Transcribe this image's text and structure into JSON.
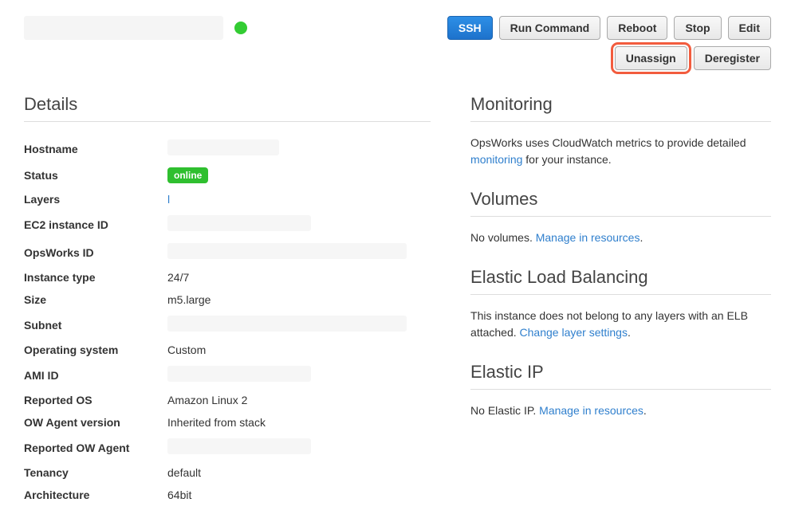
{
  "toolbar": {
    "ssh": "SSH",
    "run_command": "Run Command",
    "reboot": "Reboot",
    "stop": "Stop",
    "edit": "Edit",
    "unassign": "Unassign",
    "deregister": "Deregister"
  },
  "details": {
    "heading": "Details",
    "rows": {
      "hostname_label": "Hostname",
      "status_label": "Status",
      "status_badge": "online",
      "layers_label": "Layers",
      "layers_value": "l",
      "ec2id_label": "EC2 instance ID",
      "opsworksid_label": "OpsWorks ID",
      "instance_type_label": "Instance type",
      "instance_type_value": "24/7",
      "size_label": "Size",
      "size_value": "m5.large",
      "subnet_label": "Subnet",
      "os_label": "Operating system",
      "os_value": "Custom",
      "amiid_label": "AMI ID",
      "reported_os_label": "Reported OS",
      "reported_os_value": "Amazon Linux 2",
      "ow_agent_label": "OW Agent version",
      "ow_agent_value": "Inherited from stack",
      "reported_ow_agent_label": "Reported OW Agent",
      "tenancy_label": "Tenancy",
      "tenancy_value": "default",
      "architecture_label": "Architecture",
      "architecture_value": "64bit"
    }
  },
  "monitoring": {
    "heading": "Monitoring",
    "text_pre": "OpsWorks uses CloudWatch metrics to provide detailed ",
    "link": "monitoring",
    "text_post": " for your instance."
  },
  "volumes": {
    "heading": "Volumes",
    "text_pre": "No volumes. ",
    "link": "Manage in resources",
    "text_post": "."
  },
  "elb": {
    "heading": "Elastic Load Balancing",
    "text_pre": "This instance does not belong to any layers with an ELB attached. ",
    "link": "Change layer settings",
    "text_post": "."
  },
  "eip": {
    "heading": "Elastic IP",
    "text_pre": "No Elastic IP. ",
    "link": "Manage in resources",
    "text_post": "."
  }
}
